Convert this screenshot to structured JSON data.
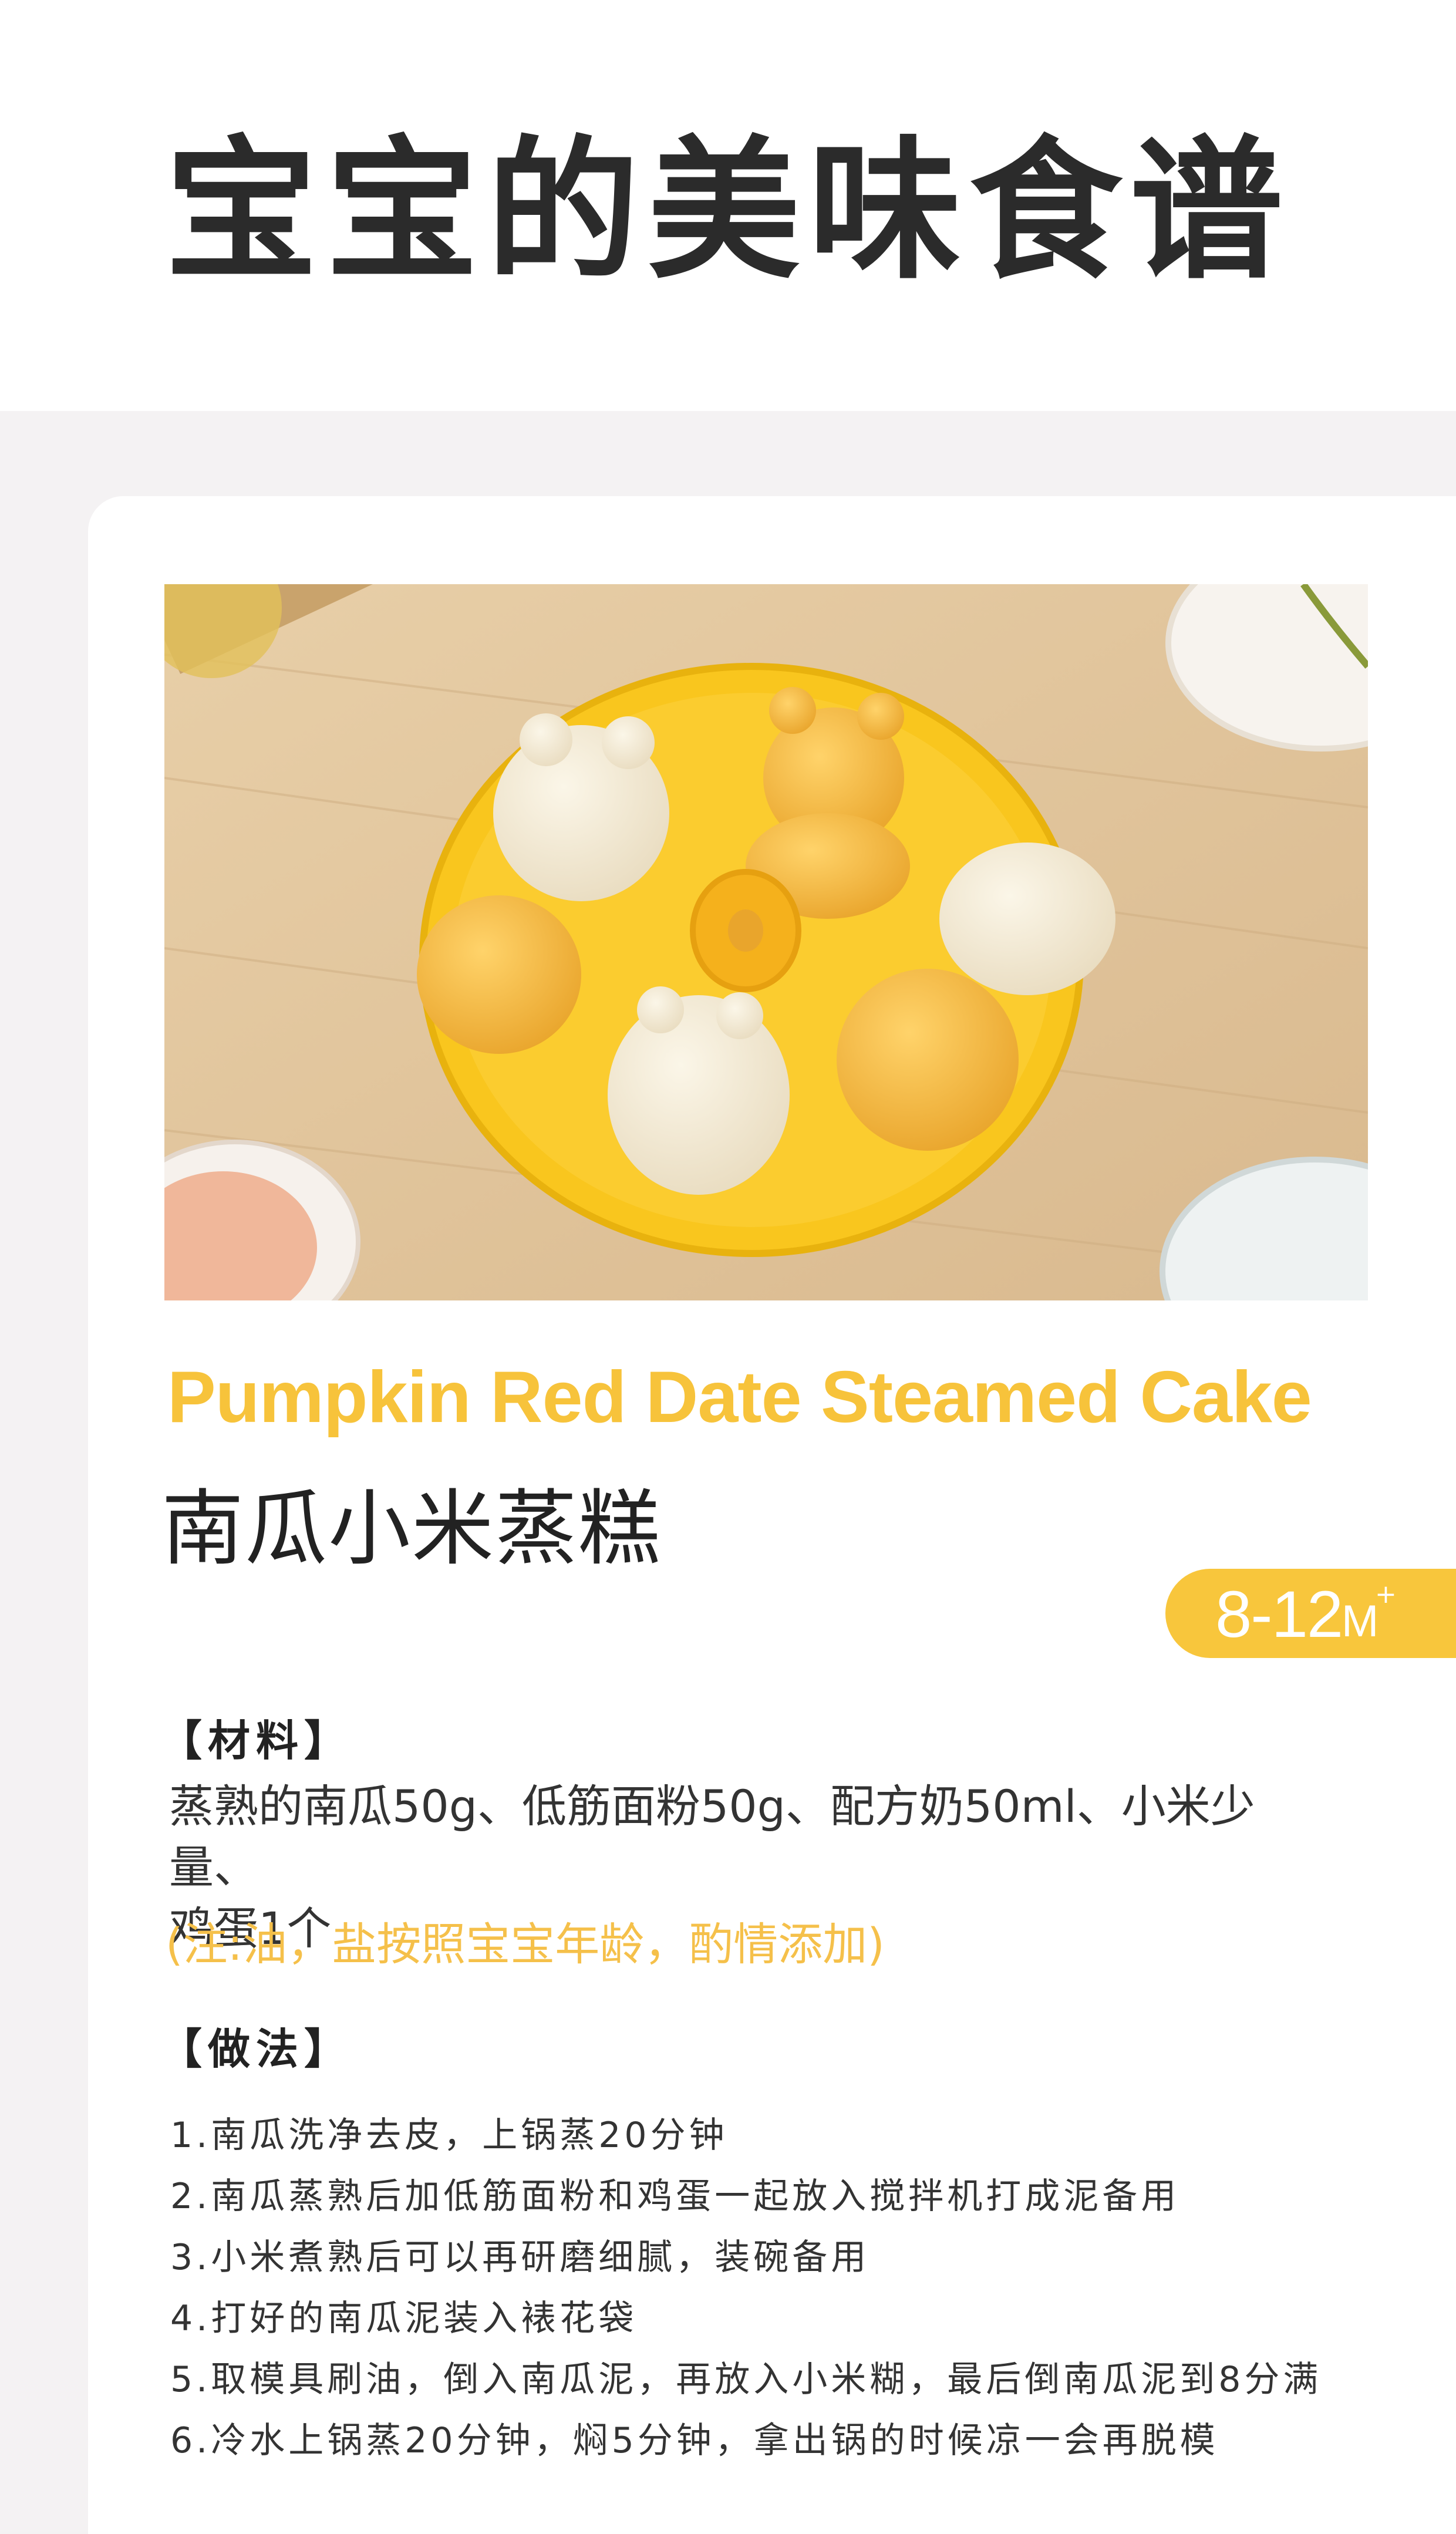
{
  "page": {
    "title": "宝宝的美味食谱"
  },
  "recipe": {
    "photo_icon": "steamed-cake-mold-photo",
    "en_title": "Pumpkin Red Date Steamed Cake",
    "cn_title": "南瓜小米蒸糕",
    "age": {
      "range": "8-12",
      "unit": "M",
      "plus": "+"
    },
    "materials_label": "【材料】",
    "ingredients": [
      "蒸熟的南瓜50g、低筋面粉50g、配方奶50ml、小米少量、",
      "鸡蛋1个"
    ],
    "note": "(注:油，盐按照宝宝年龄，酌情添加)",
    "method_label": "【做法】",
    "steps": [
      "1.南瓜洗净去皮，上锅蒸20分钟",
      "2.南瓜蒸熟后加低筋面粉和鸡蛋一起放入搅拌机打成泥备用",
      "3.小米煮熟后可以再研磨细腻，装碗备用",
      "4.打好的南瓜泥装入裱花袋",
      "5.取模具刷油，倒入南瓜泥，再放入小米糊，最后倒南瓜泥到8分满",
      "6.冷水上锅蒸20分钟，焖5分钟，拿出锅的时候凉一会再脱模"
    ]
  },
  "colors": {
    "accent": "#f8c63c",
    "title_text": "#2b2b2b",
    "background": "#f4f2f3"
  }
}
